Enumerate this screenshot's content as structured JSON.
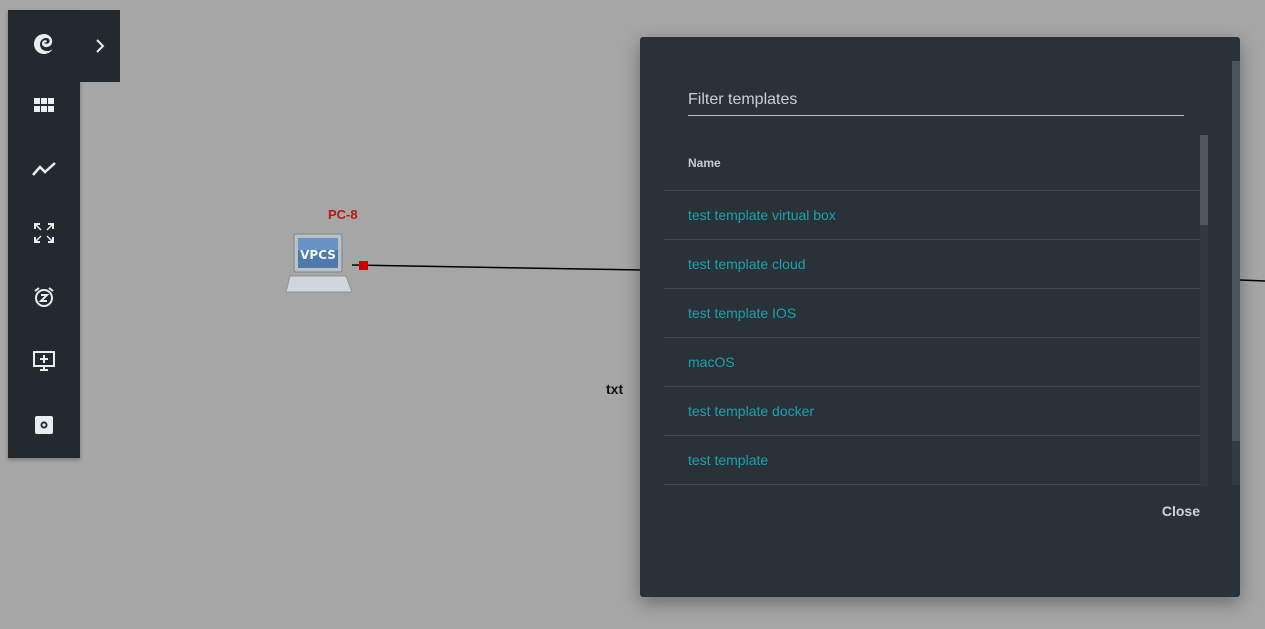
{
  "toolbar": {
    "items": [
      {
        "icon": "gns3-logo-icon"
      },
      {
        "icon": "grid-icon"
      },
      {
        "icon": "chart-line-icon"
      },
      {
        "icon": "fullscreen-icon"
      },
      {
        "icon": "snooze-alarm-icon"
      },
      {
        "icon": "add-screen-icon"
      },
      {
        "icon": "settings-icon"
      }
    ],
    "expand_icon": "chevron-right-icon"
  },
  "topology": {
    "node": {
      "label": "PC-8",
      "type_text": "VPCS"
    },
    "text_annotation": "txt"
  },
  "template_dialog": {
    "filter_placeholder": "Filter templates",
    "column_header": "Name",
    "templates": [
      "test template virtual box",
      "test template cloud",
      "test template IOS",
      "macOS",
      "test template docker",
      "test template"
    ],
    "close_label": "Close"
  },
  "colors": {
    "canvas": "#a6a6a6",
    "toolbar": "#222a30",
    "dialog": "#283238",
    "link_text": "#1fa1ad",
    "node_label": "#b81818"
  }
}
